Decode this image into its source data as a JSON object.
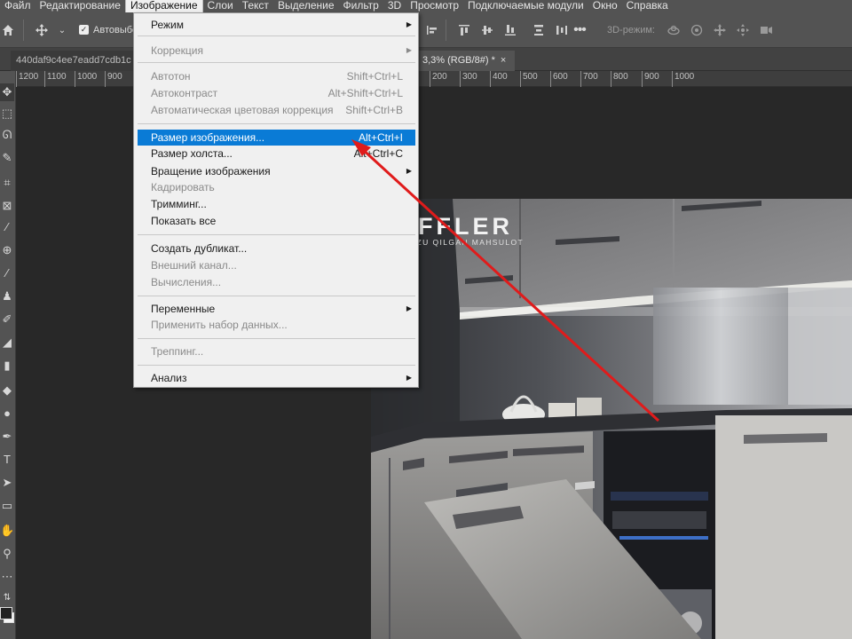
{
  "menubar": {
    "items": [
      "Файл",
      "Редактирование",
      "Изображение",
      "Слои",
      "Текст",
      "Выделение",
      "Фильтр",
      "3D",
      "Просмотр",
      "Подключаемые модули",
      "Окно",
      "Справка"
    ]
  },
  "options": {
    "auto_select_label": "Автовыбо",
    "mode_3d_label": "3D-режим:"
  },
  "tabs": {
    "doc1": "440daf9c4ee7eadd7cdb1c",
    "doc2": "3,3% (RGB/8#) *",
    "close": "×"
  },
  "ruler": {
    "ticks": [
      "1200",
      "1100",
      "1000",
      "900",
      "200",
      "300",
      "400",
      "500",
      "600",
      "700",
      "800",
      "900",
      "1000"
    ]
  },
  "image_menu": {
    "items": [
      {
        "label": "Режим",
        "shortcut": "",
        "submenu": true,
        "disabled": false
      },
      {
        "label": "Коррекция",
        "shortcut": "",
        "submenu": true,
        "disabled": true
      },
      {
        "label": "Автотон",
        "shortcut": "Shift+Ctrl+L",
        "submenu": false,
        "disabled": true
      },
      {
        "label": "Автоконтраст",
        "shortcut": "Alt+Shift+Ctrl+L",
        "submenu": false,
        "disabled": true
      },
      {
        "label": "Автоматическая цветовая коррекция",
        "shortcut": "Shift+Ctrl+B",
        "submenu": false,
        "disabled": true
      },
      {
        "label": "Размер изображения...",
        "shortcut": "Alt+Ctrl+I",
        "submenu": false,
        "disabled": false,
        "highlighted": true
      },
      {
        "label": "Размер холста...",
        "shortcut": "Alt+Ctrl+C",
        "submenu": false,
        "disabled": false
      },
      {
        "label": "Вращение изображения",
        "shortcut": "",
        "submenu": true,
        "disabled": false
      },
      {
        "label": "Кадрировать",
        "shortcut": "",
        "submenu": false,
        "disabled": true
      },
      {
        "label": "Тримминг...",
        "shortcut": "",
        "submenu": false,
        "disabled": false
      },
      {
        "label": "Показать все",
        "shortcut": "",
        "submenu": false,
        "disabled": false
      },
      {
        "label": "Создать дубликат...",
        "shortcut": "",
        "submenu": false,
        "disabled": false
      },
      {
        "label": "Внешний канал...",
        "shortcut": "",
        "submenu": false,
        "disabled": true
      },
      {
        "label": "Вычисления...",
        "shortcut": "",
        "submenu": false,
        "disabled": true
      },
      {
        "label": "Переменные",
        "shortcut": "",
        "submenu": true,
        "disabled": false
      },
      {
        "label": "Применить набор данных...",
        "shortcut": "",
        "submenu": false,
        "disabled": true
      },
      {
        "label": "Треппинг...",
        "shortcut": "",
        "submenu": false,
        "disabled": true
      },
      {
        "label": "Анализ",
        "shortcut": "",
        "submenu": true,
        "disabled": false
      }
    ]
  },
  "canvas": {
    "logo_text": "FFLER",
    "logo_sub": "ORZU QILGAN MAHSULOT"
  },
  "colors": {
    "highlight": "#0a7bd6",
    "arrow": "#e01b1b",
    "ui_bg": "#535353"
  }
}
